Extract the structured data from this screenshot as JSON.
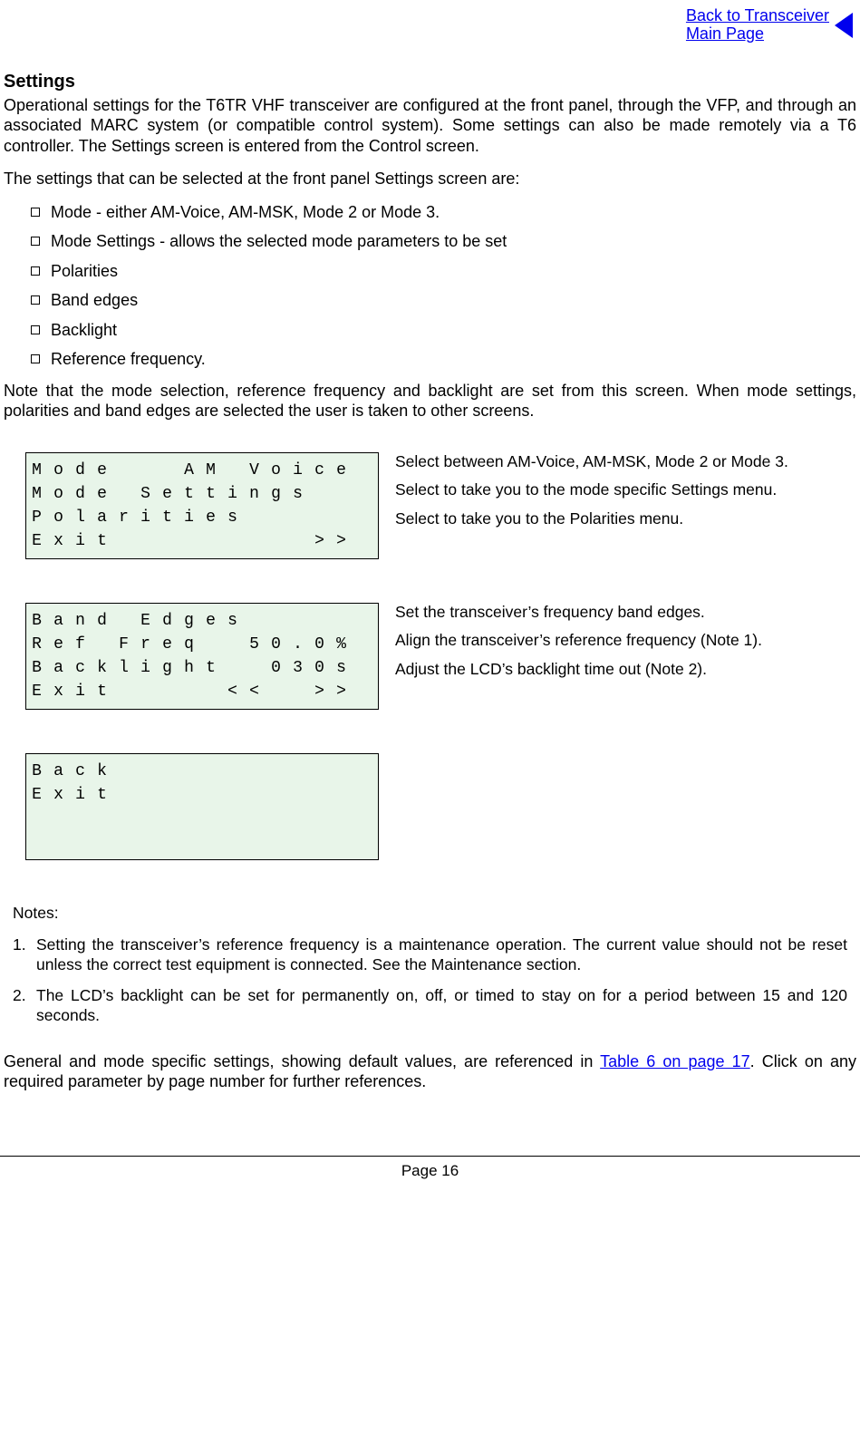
{
  "toplink": {
    "line1": "Back to Transceiver",
    "line2": "Main Page"
  },
  "heading": "Settings",
  "intro": "Operational settings for the T6TR VHF transceiver are configured at the front panel, through the VFP, and through an associated MARC system (or compatible control system). Some settings can also be made remotely via a T6 controller. The Settings screen is entered from the Control screen.",
  "list_lead": "The settings that can be selected at the front panel Settings screen are:",
  "bullets": [
    "Mode - either AM-Voice, AM-MSK, Mode 2 or Mode 3.",
    "Mode Settings - allows the selected mode parameters to be set",
    "Polarities",
    "Band edges",
    "Backlight",
    "Reference frequency."
  ],
  "note_after_list": "Note that the mode selection, reference frequency and backlight are set from this screen. When mode settings, polarities and band edges are selected the user is taken to other screens.",
  "screen1": {
    "rows": [
      [
        "M",
        "o",
        "d",
        "e",
        "",
        "",
        "",
        "A",
        "M",
        "",
        "V",
        "o",
        "i",
        "c",
        "e"
      ],
      [
        "M",
        "o",
        "d",
        "e",
        "",
        "S",
        "e",
        "t",
        "t",
        "i",
        "n",
        "g",
        "s",
        "",
        ""
      ],
      [
        "P",
        "o",
        "l",
        "a",
        "r",
        "i",
        "t",
        "i",
        "e",
        "s",
        "",
        "",
        "",
        "",
        ""
      ],
      [
        "E",
        "x",
        "i",
        "t",
        "",
        "",
        "",
        "",
        "",
        "",
        "",
        "",
        "",
        ">",
        ">"
      ]
    ],
    "annots": [
      "Select between AM-Voice, AM-MSK, Mode 2 or Mode 3.",
      "Select to take you to the mode specific Settings menu.",
      "Select to take you to the Polarities menu."
    ]
  },
  "screen2": {
    "rows": [
      [
        "B",
        "a",
        "n",
        "d",
        "",
        "E",
        "d",
        "g",
        "e",
        "s",
        "",
        "",
        "",
        "",
        ""
      ],
      [
        "R",
        "e",
        "f",
        "",
        "F",
        "r",
        "e",
        "q",
        "",
        "",
        "5",
        "0",
        ".",
        "0",
        "%"
      ],
      [
        "B",
        "a",
        "c",
        "k",
        "l",
        "i",
        "g",
        "h",
        "t",
        "",
        "",
        "0",
        "3",
        "0",
        "s"
      ],
      [
        "E",
        "x",
        "i",
        "t",
        "",
        "",
        "",
        "",
        "",
        "<",
        "<",
        "",
        "",
        ">",
        ">"
      ]
    ],
    "annots": [
      "Set the transceiver’s frequency band edges.",
      "Align the transceiver’s reference frequency (Note 1).",
      "Adjust the LCD’s backlight time out (Note 2)."
    ]
  },
  "screen3": {
    "rows": [
      [
        "B",
        "a",
        "c",
        "k",
        "",
        "",
        "",
        "",
        "",
        "",
        "",
        "",
        "",
        "",
        ""
      ],
      [
        "E",
        "x",
        "i",
        "t",
        "",
        "",
        "",
        "",
        "",
        "",
        "",
        "",
        "",
        "",
        ""
      ],
      [
        "",
        "",
        "",
        "",
        "",
        "",
        "",
        "",
        "",
        "",
        "",
        "",
        "",
        "",
        ""
      ],
      [
        "",
        "",
        "",
        "",
        "",
        "",
        "",
        "",
        "",
        "",
        "",
        "",
        "",
        "",
        ""
      ]
    ]
  },
  "notes_heading": "Notes:",
  "notes": [
    "Setting the transceiver’s reference frequency is a maintenance operation. The current value should not be reset unless the correct test equipment is connected. See the Maintenance section.",
    "The LCD’s backlight can be set for permanently on, off, or timed to stay on for a period between 15 and 120 seconds."
  ],
  "closing_pre": "General and mode specific settings, showing default values, are referenced in ",
  "closing_link": "Table 6 on page 17",
  "closing_post": ". Click on any required parameter by page number for further references.",
  "page_label": "Page 16"
}
